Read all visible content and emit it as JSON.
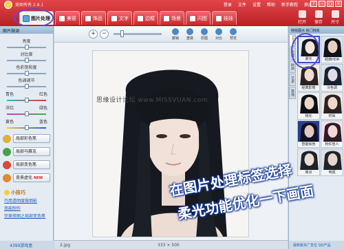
{
  "window": {
    "title": "美图秀秀 2.8.1",
    "menu": [
      "登录",
      "文件",
      "设置",
      "帮助",
      "新手教程",
      "换皮肤"
    ],
    "controls": [
      "?",
      "-",
      "□",
      "×"
    ]
  },
  "tabs": [
    {
      "label": "图片处理",
      "active": true
    },
    {
      "label": "美容",
      "active": false
    },
    {
      "label": "饰品",
      "active": false
    },
    {
      "label": "文字",
      "active": false
    },
    {
      "label": "边框",
      "active": false
    },
    {
      "label": "场景",
      "active": false
    },
    {
      "label": "闪图",
      "active": false
    },
    {
      "label": "娃娃",
      "active": false
    }
  ],
  "top_actions": [
    "打开",
    "保存",
    "尺寸"
  ],
  "left_panel": {
    "title": "图片微调",
    "sliders": [
      {
        "label": "亮度",
        "level": 0.5
      },
      {
        "label": "对比度",
        "level": 0.5
      },
      {
        "label": "色彩饱和度",
        "level": 0.5
      },
      {
        "label": "色调调节",
        "level": 0.5
      }
    ],
    "color_rows": [
      {
        "left": "青色",
        "right": "红色",
        "level": 0.5
      },
      {
        "left": "洋红",
        "right": "绿色",
        "level": 0.5
      },
      {
        "left": "黄色",
        "right": "蓝色",
        "level": 0.5
      }
    ],
    "buttons": [
      {
        "label": "局部彩色笔",
        "new": false
      },
      {
        "label": "局部马赛克",
        "new": false
      },
      {
        "label": "局部变色笔",
        "new": false
      },
      {
        "label": "背景虚化",
        "new": true
      }
    ],
    "new_badge": "NEW",
    "tips_title": "小技巧",
    "tips": [
      "巧用透明度做倒影",
      "我能制作",
      "完美修图之局部变色笔"
    ],
    "footer": "4399游戏盒"
  },
  "toolbar": {
    "tools": [
      "撤销",
      "重做",
      "原图",
      "对比",
      "预览"
    ]
  },
  "canvas": {
    "filename": "2.jpg",
    "dimensions": "333 × 500"
  },
  "overlay": {
    "watermark": "思缘设计论坛 www.MISSVUAN.com",
    "caption_line1": "在图片处理标签选择",
    "caption_line2": "柔光功能优化一下画面"
  },
  "right_panel": {
    "title": "特效展示  热门特效",
    "vtabs": [
      "LOMO",
      "影楼",
      "时尚",
      "艺术",
      "其他"
    ],
    "effects": [
      {
        "label": "柔光",
        "selected": true
      },
      {
        "label": "经典HDR",
        "selected": false
      },
      {
        "label": "经典影楼",
        "selected": false
      },
      {
        "label": "冷色调",
        "selected": false
      },
      {
        "label": "锐化",
        "selected": false
      },
      {
        "label": "时尚",
        "selected": false
      },
      {
        "label": "智能绘色",
        "selected": false
      },
      {
        "label": "粉红佳人",
        "selected": false
      },
      {
        "label": "候点",
        "selected": false
      },
      {
        "label": "电视",
        "selected": false
      }
    ],
    "footer": "最新版本广告位 QQ产品"
  }
}
